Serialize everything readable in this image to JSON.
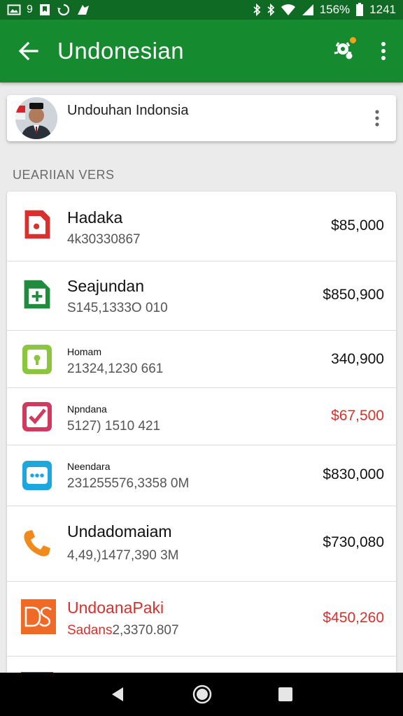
{
  "status_bar": {
    "battery": "156%",
    "time": "1241"
  },
  "app_bar": {
    "title": "Undonesian"
  },
  "account": {
    "name": "Undouhan Indonsia"
  },
  "section": {
    "header": "UEARIIAN VERS"
  },
  "items": [
    {
      "name": "Hadaka",
      "sub": "4k30330867",
      "amount": "$85,000",
      "icon": "red-document-icon"
    },
    {
      "name": "Seajundan",
      "sub": "S145,1333O 010",
      "amount": "$850,900",
      "icon": "green-plus-document-icon"
    },
    {
      "name": "Homam",
      "sub": "21324,1230 661",
      "amount": "340,900",
      "icon": "lime-lock-icon"
    },
    {
      "name": "Npndana",
      "sub": "5127) 1510 421",
      "amount": "$67,500",
      "icon": "magenta-check-icon"
    },
    {
      "name": "Neendara",
      "sub": "231255576,3358 0M",
      "amount": "$830,000",
      "icon": "blue-chat-icon"
    },
    {
      "name": "Undadomaiam",
      "sub": "4,49,)1477,390 3M",
      "amount": "$730,080",
      "icon": "orange-phone-icon"
    },
    {
      "name": "UndoanaPaki",
      "sub_prefix": "Sadans",
      "sub": "2,3370.807",
      "amount": "$450,260",
      "icon": "orange-ds-icon"
    }
  ],
  "colors": {
    "app_bar": "#168a2e",
    "status_bar": "#0f6a23",
    "negative": "#d8302c"
  }
}
